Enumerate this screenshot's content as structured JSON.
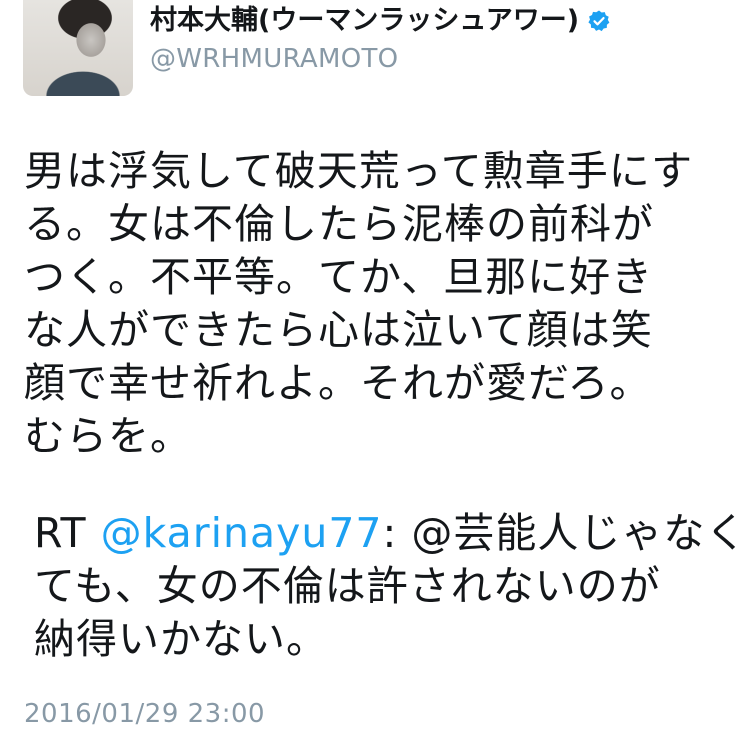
{
  "user": {
    "display_name": "村本大輔(ウーマンラッシュアワー)",
    "handle": "@WRHMURAMOTO",
    "verified": true,
    "verified_icon": "verified-badge-icon",
    "verified_color": "#1da1f2"
  },
  "tweet": {
    "lines": [
      "男は浮気して破天荒って勲章手にす",
      "る。女は不倫したら泥棒の前科が",
      "つく。不平等。てか、旦那に好き",
      "な人ができたら心は泣いて顔は笑",
      "顔で幸せ祈れよ。それが愛だろ。",
      "むらを。"
    ]
  },
  "retweet": {
    "prefix": "RT ",
    "mention": "@karinayu77",
    "line1_rest": ": @芸能人じゃなく",
    "line2": "ても、女の不倫は許されないのが",
    "line3": "納得いかない。",
    "mention_color": "#1da1f2"
  },
  "timestamp": "2016/01/29 23:00"
}
